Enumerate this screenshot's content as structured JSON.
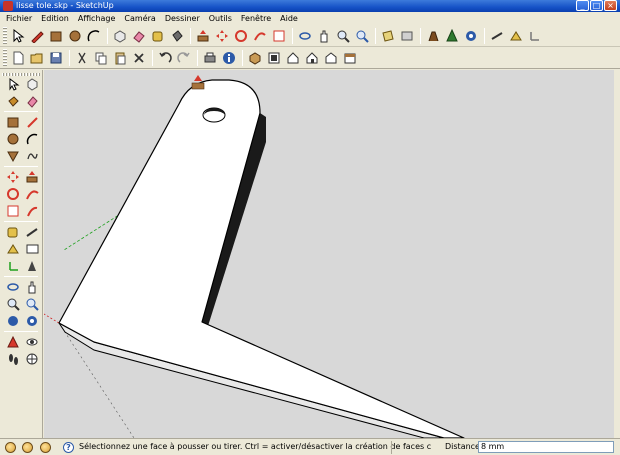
{
  "window": {
    "title": "lisse tole.skp - SketchUp",
    "minimize_label": "_",
    "maximize_label": "□",
    "close_label": "×"
  },
  "menu": {
    "items": [
      "Fichier",
      "Edition",
      "Affichage",
      "Caméra",
      "Dessiner",
      "Outils",
      "Fenêtre",
      "Aide"
    ]
  },
  "toolbar_top": {
    "icons": [
      "select-icon",
      "pencil-icon",
      "rectangle-icon",
      "circle-icon",
      "arc-icon",
      "eraser-icon",
      "paint-bucket-icon",
      "push-pull-icon",
      "tape-measure-icon",
      "move-icon",
      "rotate-icon",
      "follow-me-icon",
      "scale-icon",
      "offset-icon",
      "orbit-icon",
      "pan-icon",
      "zoom-icon",
      "zoom-extents-icon",
      "section-plane-icon",
      "3d-text-icon",
      "walk-icon",
      "position-camera-icon",
      "look-around-icon",
      "dimension-icon",
      "protractor-icon",
      "axes-icon"
    ]
  },
  "toolbar_std": {
    "icons": [
      "new-icon",
      "open-icon",
      "save-icon",
      "cut-icon",
      "copy-icon",
      "paste-icon",
      "delete-icon",
      "undo-icon",
      "redo-icon",
      "print-icon",
      "model-info-icon",
      "iso-view-icon",
      "top-view-icon",
      "front-view-icon",
      "right-view-icon",
      "back-view-icon",
      "left-view-icon"
    ]
  },
  "left_tools": {
    "icons": [
      "select-icon",
      "make-component-icon",
      "paint-bucket-icon",
      "eraser-icon",
      "rectangle-icon",
      "line-icon",
      "circle-icon",
      "arc-icon",
      "polygon-icon",
      "freehand-icon",
      "move-icon",
      "push-pull-icon",
      "rotate-icon",
      "follow-me-icon",
      "scale-icon",
      "offset-icon",
      "tape-measure-icon",
      "dimension-icon",
      "protractor-icon",
      "text-icon",
      "axes-icon",
      "3d-text-icon",
      "orbit-icon",
      "pan-icon",
      "zoom-icon",
      "zoom-window-icon",
      "previous-view-icon",
      "zoom-extents-icon",
      "position-camera-icon",
      "look-around-icon",
      "walk-icon",
      "section-plane-icon"
    ]
  },
  "status": {
    "message": "Sélectionnez une face à pousser ou tirer. Ctrl = activer/désactiver la création de faces c",
    "help_label": "?",
    "measure_label": "Distance",
    "measure_value": "8 mm"
  },
  "colors": {
    "titlebar": "#1652c7",
    "chrome": "#ece9d8",
    "viewport_bg": "#d8d8d8",
    "model_face": "#ffffff",
    "model_edge": "#000000",
    "green_axis": "#1ea01e",
    "red_axis": "#d02020"
  }
}
